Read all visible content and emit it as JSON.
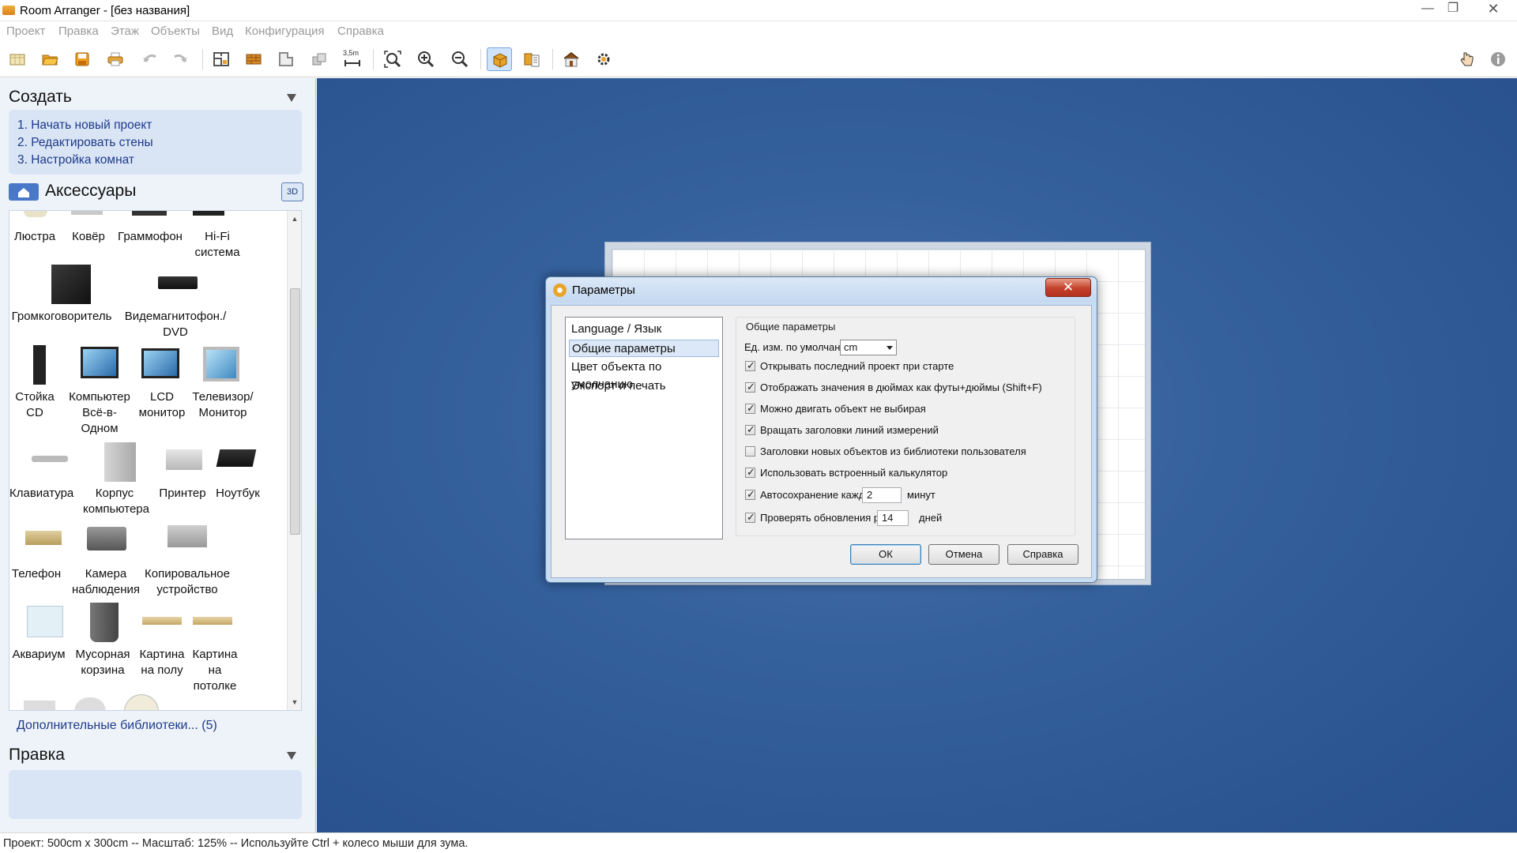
{
  "window": {
    "title": "Room Arranger - [без названия]"
  },
  "menu": [
    "Проект",
    "Правка",
    "Этаж",
    "Объекты",
    "Вид",
    "Конфигурация",
    "Справка"
  ],
  "toolbar": {
    "scale_label": "3,5m"
  },
  "create_panel": {
    "title": "Создать",
    "items": [
      "1. Начать новый проект",
      "2. Редактировать стены",
      "3. Настройка комнат"
    ]
  },
  "accessories": {
    "title": "Аксессуары",
    "btn3d": "3D",
    "items": [
      "Люстра",
      "Ковёр",
      "Граммофон",
      "Hi-Fi система",
      "Громкоговоритель",
      "Видемагнитофон./ DVD",
      "Стойка CD",
      "Компьютер Всё-в-Одном",
      "LCD монитор",
      "Телевизор/ Монитор",
      "Клавиатура",
      "Корпус компьютера",
      "Принтер",
      "Ноутбук",
      "Телефон",
      "Камера наблюдения",
      "Копировальное устройство",
      "Аквариум",
      "Мусорная корзина",
      "Картина на полу",
      "Картина на потолке"
    ],
    "more_libraries": "Дополнительные библиотеки... (5)"
  },
  "edit_panel": {
    "title": "Правка"
  },
  "status": {
    "text": "Проект: 500cm x 300cm -- Масштаб: 125% -- Используйте Ctrl + колесо мыши для зума."
  },
  "dialog": {
    "title": "Параметры",
    "close_label": "✕",
    "categories": [
      "Language / Язык",
      "Общие параметры",
      "Цвет объекта по умолчанию",
      "Экспорт и печать"
    ],
    "selected_category": "Общие параметры",
    "group_title": "Общие параметры",
    "unit_label": "Ед. изм. по умолчанию:",
    "unit_value": "cm",
    "options": [
      {
        "label": "Открывать последний проект при старте",
        "checked": true
      },
      {
        "label": "Отображать значения в дюймах как футы+дюймы (Shift+F)",
        "checked": true
      },
      {
        "label": "Можно двигать объект не выбирая",
        "checked": true
      },
      {
        "label": "Вращать заголовки линий измерений",
        "checked": true
      },
      {
        "label": "Заголовки новых объектов из библиотеки пользователя",
        "checked": false
      },
      {
        "label": "Использовать встроенный калькулятор",
        "checked": true
      }
    ],
    "autosave": {
      "label": "Автосохранение каждые",
      "value": "2",
      "unit": "минут",
      "checked": true
    },
    "updates": {
      "label": "Проверять обновления раз в",
      "value": "14",
      "unit": "дней",
      "checked": true
    },
    "buttons": {
      "ok": "ОК",
      "cancel": "Отмена",
      "help": "Справка"
    }
  },
  "colors": {
    "canvas_blue": "#34609c",
    "panel_bg": "#eef3f9",
    "link_blue": "#1e3a8a",
    "dialog_frame": "#c8dcf2"
  }
}
